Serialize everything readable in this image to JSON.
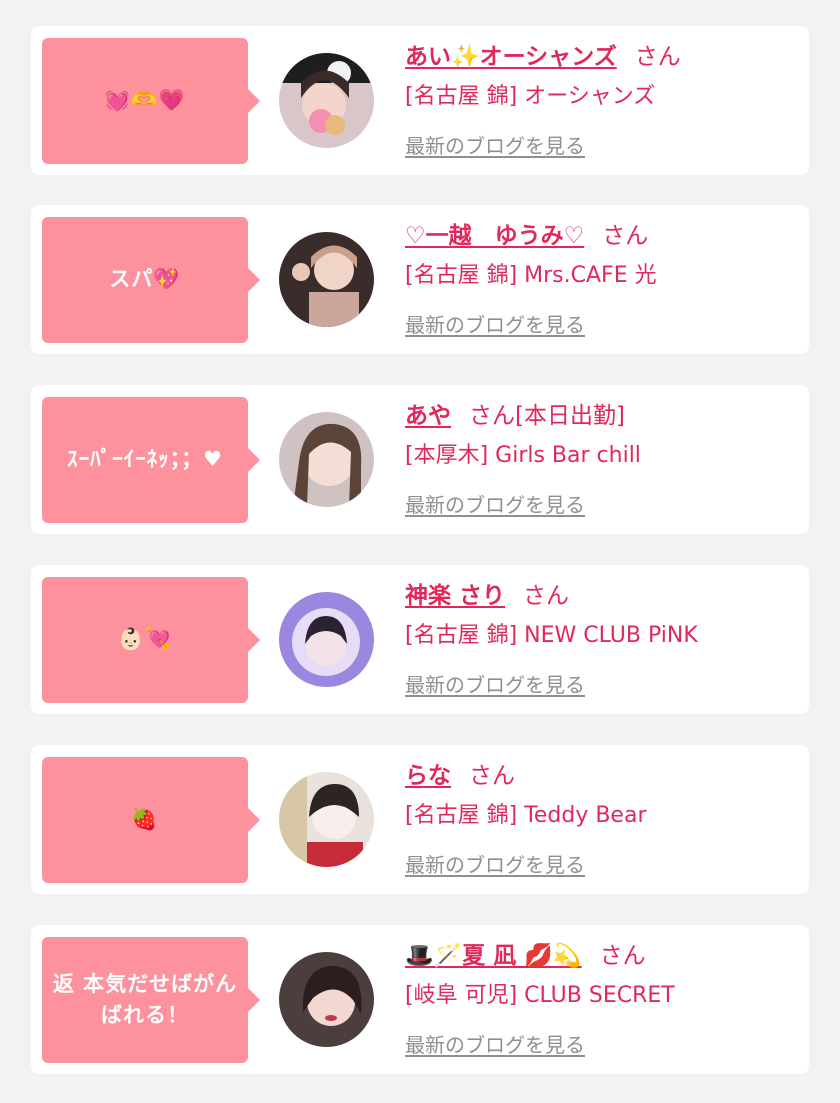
{
  "colors": {
    "accent": "#e0295a",
    "bubble": "#fd919d",
    "background": "#f2f2f2",
    "link_gray": "#8f8f8f"
  },
  "cards": [
    {
      "bubble_text": "💓🫶💗",
      "name": "あい✨オーシャンズ",
      "suffix": "さん",
      "shop": "[名古屋 錦] オーシャンズ",
      "blog_link": "最新のブログを見る"
    },
    {
      "bubble_text": "スパ💖",
      "name": "♡一越　ゆうみ♡",
      "suffix": "さん",
      "shop": "[名古屋 錦] Mrs.CAFE 光",
      "blog_link": "最新のブログを見る"
    },
    {
      "bubble_text": "ｽｰﾊﾟｰｲｰﾈｯ；；♥",
      "name": "あや",
      "suffix": "さん[本日出勤]",
      "shop": "[本厚木] Girls Bar chill",
      "blog_link": "最新のブログを見る"
    },
    {
      "bubble_text": "👶🏻💘",
      "name": "神楽 さり",
      "suffix": "さん",
      "shop": "[名古屋 錦] NEW CLUB PiNK",
      "blog_link": "最新のブログを見る"
    },
    {
      "bubble_text": "🍓",
      "name": "らな",
      "suffix": "さん",
      "shop": "[名古屋 錦] Teddy Bear",
      "blog_link": "最新のブログを見る"
    },
    {
      "bubble_text": "返 本気だせばがんばれる！",
      "name": "🎩🪄夏 凪 💋💫",
      "suffix": "さん",
      "shop": "[岐阜 可児] CLUB SECRET",
      "blog_link": "最新のブログを見る"
    }
  ]
}
